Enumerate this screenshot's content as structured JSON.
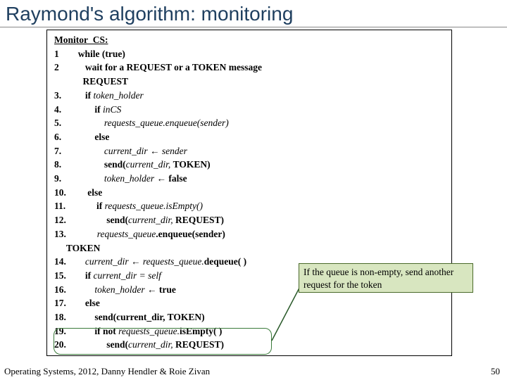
{
  "title": "Raymond's algorithm: monitoring",
  "code": {
    "header": "Monitor_CS:",
    "lines": [
      {
        "n": "1",
        "pre": "     ",
        "t": "while (true)",
        "bold": true
      },
      {
        "n": "2",
        "pre": "        ",
        "t": "wait for a REQUEST or a TOKEN message",
        "bold": true
      },
      {
        "n": "",
        "pre": "        ",
        "t": "REQUEST",
        "bold": true
      },
      {
        "n": "3.",
        "pre": "        ",
        "t": "if",
        "bold": true,
        "tail": " token_holder",
        "tail_i": true
      },
      {
        "n": "4.",
        "pre": "            ",
        "t": "if",
        "bold": true,
        "tail": " inCS",
        "tail_i": true
      },
      {
        "n": "5.",
        "pre": "                ",
        "t": "requests_queue.enqueue(sender)",
        "italic": true
      },
      {
        "n": "6.",
        "pre": "            ",
        "t": "else",
        "bold": true
      },
      {
        "n": "7.",
        "pre": "                ",
        "tail": "current_dir",
        "tail_i": true,
        "arrow": " ← ",
        "tail2": "sender",
        "tail2_i": true,
        "bold": true
      },
      {
        "n": "8.",
        "pre": "                ",
        "t": "send(",
        "bold": true,
        "mid": "current_dir, ",
        "mid_i": true,
        "end": "TOKEN)",
        "end_b": true
      },
      {
        "n": "9.",
        "pre": "                ",
        "tail": "token_holder",
        "tail_i": true,
        "arrow": " ← ",
        "tail2": "false",
        "tail2_b": true
      },
      {
        "n": "10.",
        "pre": "        ",
        "t": "else",
        "bold": true
      },
      {
        "n": "11.",
        "pre": "            ",
        "t": "if",
        "bold": true,
        "tail": " requests_queue.isEmpty()",
        "tail_i": true
      },
      {
        "n": "12.",
        "pre": "                ",
        "t": "send(",
        "bold": true,
        "mid": "current_dir, ",
        "mid_i": true,
        "end": "REQUEST)",
        "end_b": true
      },
      {
        "n": "13.",
        "pre": "            ",
        "t": "requests_queue",
        "italic": true,
        "end": ".enqueue(sender)",
        "end_b": true
      },
      {
        "n": "",
        "pre": " ",
        "t": "TOKEN",
        "bold": true
      },
      {
        "n": "14.",
        "pre": "       ",
        "tail": "current_dir",
        "tail_i": true,
        "arrow": " ← ",
        "mid": "requests_queue.",
        "mid_i": true,
        "end": "dequeue( )",
        "end_b": true
      },
      {
        "n": "15.",
        "pre": "       ",
        "t": "if",
        "bold": true,
        "tail": " current_dir = self",
        "tail_i": true
      },
      {
        "n": "16.",
        "pre": "           ",
        "tail": "token_holder",
        "tail_i": true,
        "arrow": " ← ",
        "tail2": "true",
        "tail2_b": true
      },
      {
        "n": "17.",
        "pre": "       ",
        "t": "else",
        "bold": true
      },
      {
        "n": "18.",
        "pre": "           ",
        "t": "send(current_dir, TOKEN)",
        "bold": true
      },
      {
        "n": "19.",
        "pre": "           ",
        "t": "if not",
        "bold": true,
        "tail": " requests_queue.",
        "tail_i": true,
        "end": "isEmpty( )",
        "end_b": true
      },
      {
        "n": "20.",
        "pre": "                ",
        "t": "send(",
        "bold": true,
        "mid": "current_dir, ",
        "mid_i": true,
        "end": "REQUEST)",
        "end_b": true
      }
    ]
  },
  "annotation": "If the queue is non-empty, send another request for the token",
  "footer": "Operating Systems, 2012, Danny Hendler & Roie Zivan",
  "page": "50"
}
